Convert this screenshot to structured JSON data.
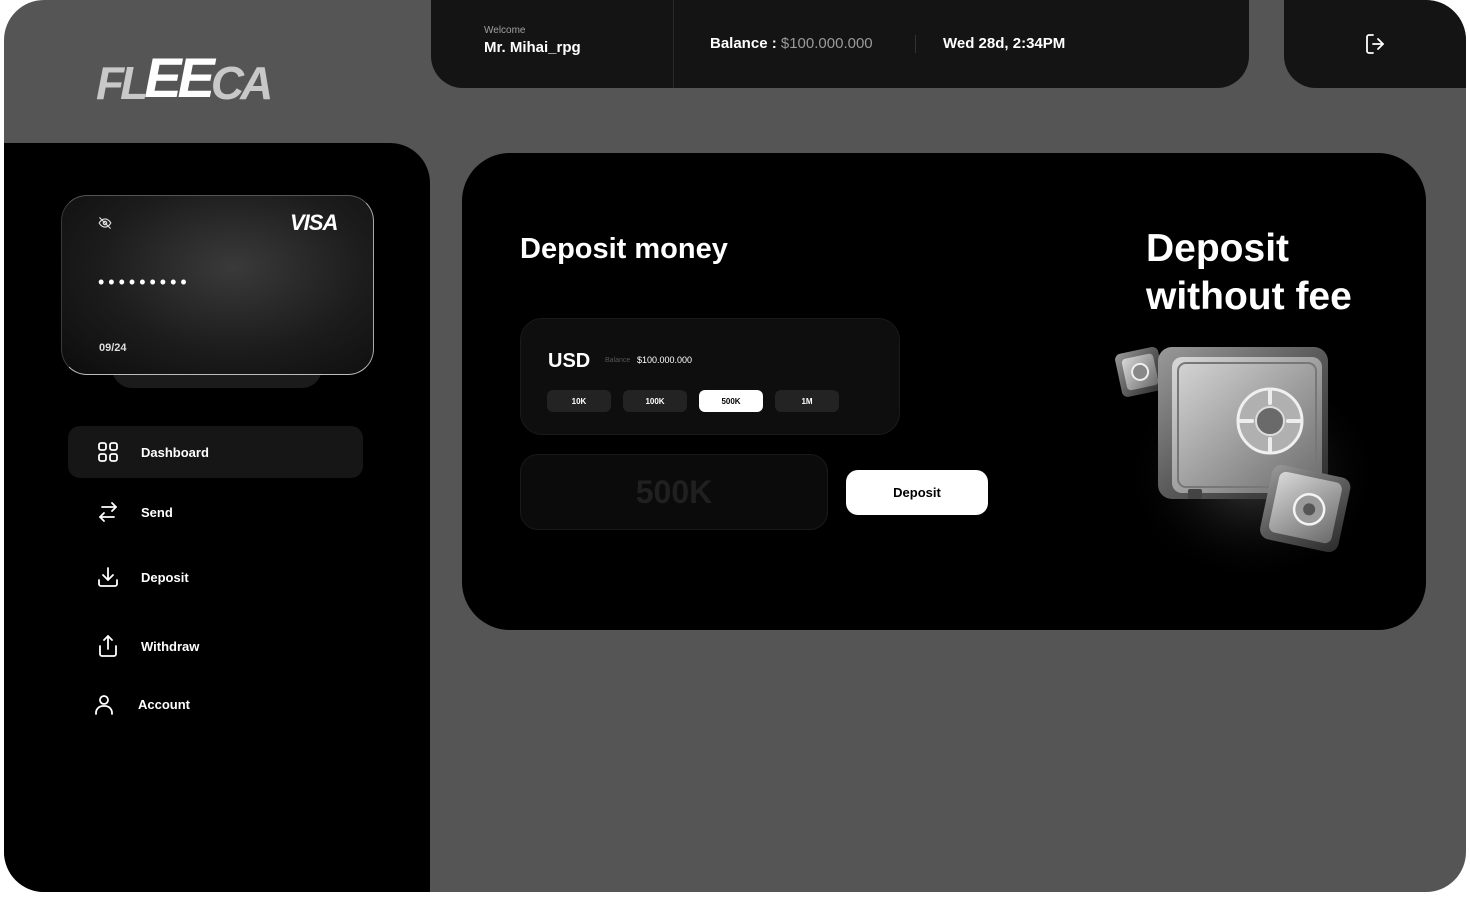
{
  "brand": {
    "logo_part1": "FL",
    "logo_part2": "EE",
    "logo_part3": "CA"
  },
  "header": {
    "welcome_label": "Welcome",
    "user_name": "Mr. Mihai_rpg",
    "balance_label": "Balance : ",
    "balance_value": "$100.000.000",
    "datetime": "Wed 28d, 2:34PM",
    "logout_icon": "logout-icon"
  },
  "card": {
    "network": "VISA",
    "masked_number": "•••••••••",
    "expiry": "09/24",
    "visibility_icon": "eye-off-icon"
  },
  "sidebar": {
    "items": [
      {
        "label": "Dashboard",
        "icon": "grid-icon",
        "active": true
      },
      {
        "label": "Send",
        "icon": "transfer-icon",
        "active": false
      },
      {
        "label": "Deposit",
        "icon": "download-icon",
        "active": false
      },
      {
        "label": "Withdraw",
        "icon": "upload-icon",
        "active": false
      },
      {
        "label": "Account",
        "icon": "user-icon",
        "active": false
      }
    ]
  },
  "deposit": {
    "title": "Deposit money",
    "currency": "USD",
    "balance_label": "Balance",
    "balance_value": "$100.000.000",
    "quick_amounts": [
      "10K",
      "100K",
      "500K",
      "1M"
    ],
    "selected_amount": "500K",
    "amount_placeholder": "500K",
    "submit_label": "Deposit"
  },
  "promo": {
    "line1": "Deposit",
    "line2": "without fee",
    "illustration": "safe-icon"
  },
  "colors": {
    "app_bg": "#555555",
    "panel_bg": "#000000",
    "header_bg": "#141414",
    "accent": "#ffffff",
    "muted_text": "#9a9a9a"
  }
}
